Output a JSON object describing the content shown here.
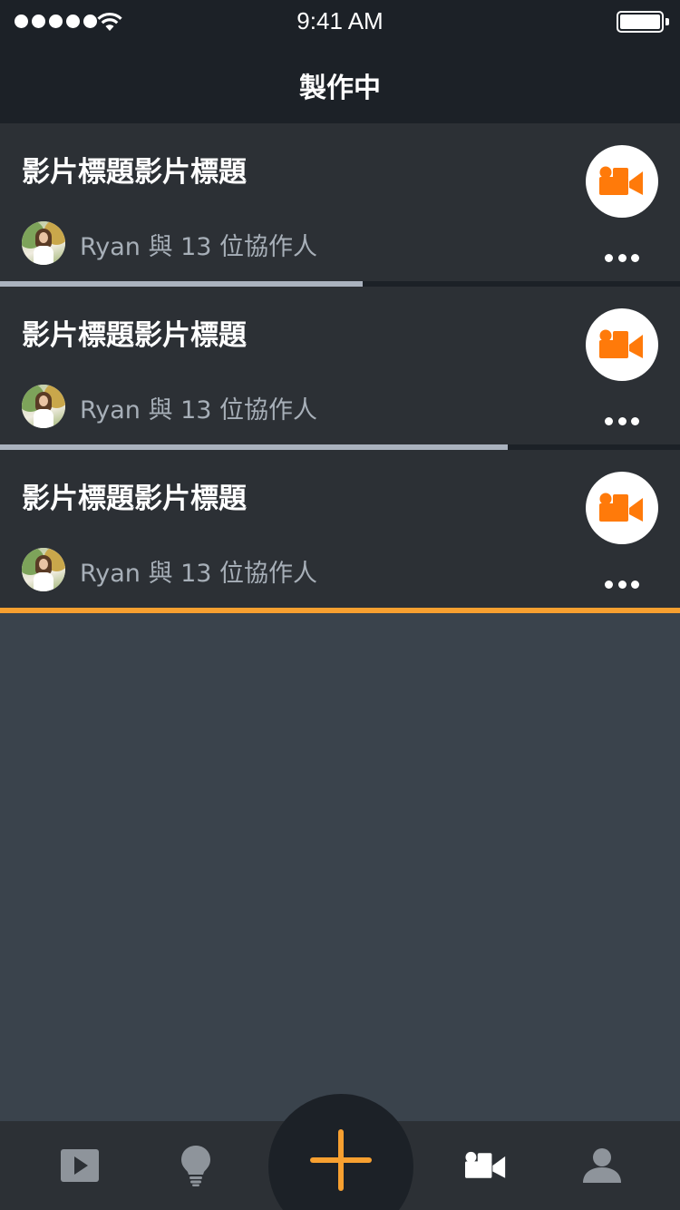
{
  "status_bar": {
    "time": "9:41 AM",
    "signal_icon": "signal-dots-icon",
    "wifi_icon": "wifi-icon",
    "battery_icon": "battery-full-icon"
  },
  "nav": {
    "title": "製作中"
  },
  "projects": [
    {
      "title": "影片標題影片標題",
      "collaborators_text": "Ryan 與 13 位協作人",
      "progress": 0.533,
      "progress_color": "#aab2be",
      "action_icon": "video-camera-icon",
      "more_icon": "more-dots-icon"
    },
    {
      "title": "影片標題影片標題",
      "collaborators_text": "Ryan 與 13 位協作人",
      "progress": 0.747,
      "progress_color": "#aab2be",
      "action_icon": "video-camera-icon",
      "more_icon": "more-dots-icon"
    },
    {
      "title": "影片標題影片標題",
      "collaborators_text": "Ryan 與 13 位協作人",
      "progress": 1.0,
      "progress_color": "#f7a030",
      "action_icon": "video-camera-icon",
      "more_icon": "more-dots-icon"
    }
  ],
  "tab_bar": {
    "tabs": [
      {
        "icon": "play-icon",
        "active": false
      },
      {
        "icon": "lightbulb-icon",
        "active": false
      },
      {
        "icon": "plus-icon",
        "active": false
      },
      {
        "icon": "video-camera-icon",
        "active": true
      },
      {
        "icon": "person-icon",
        "active": false
      }
    ]
  },
  "colors": {
    "accent": "#f7a030",
    "camera_orange": "#ff7a0a",
    "header_bg": "#1c2127",
    "card_bg": "#2c3035",
    "page_bg": "#3a434c",
    "muted_text": "#a7afb8",
    "inactive_icon": "#8e949b"
  }
}
